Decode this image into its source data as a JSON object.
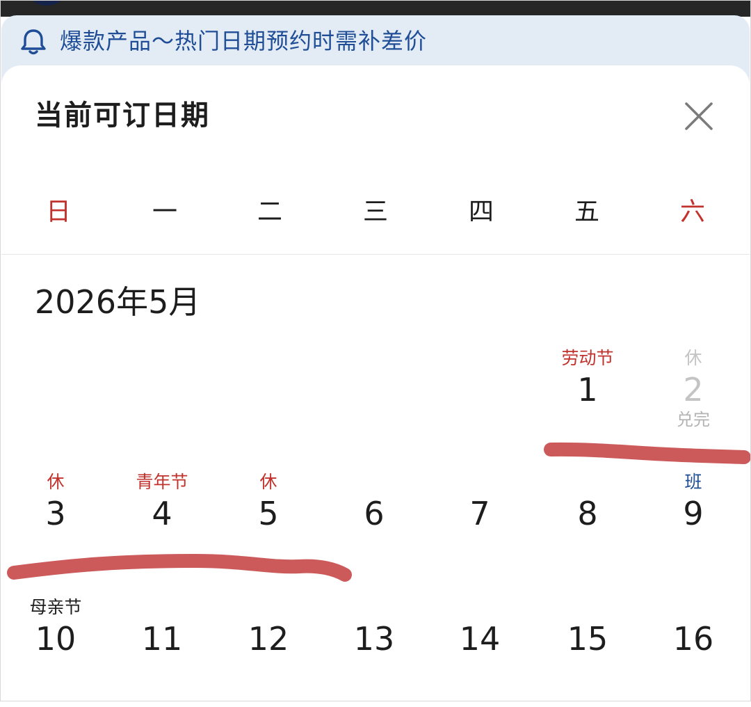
{
  "notice": {
    "icon": "bell-icon",
    "text": "爆款产品～热门日期预约时需补差价"
  },
  "sheet": {
    "title": "当前可订日期",
    "close_icon": "close-icon"
  },
  "weekdays": [
    "日",
    "一",
    "二",
    "三",
    "四",
    "五",
    "六"
  ],
  "month": "2026年5月",
  "days": [
    {
      "day": "1",
      "top": "劳动节",
      "top_style": "holiday"
    },
    {
      "day": "2",
      "top": "休",
      "bottom": "兑完",
      "disabled": true
    },
    {
      "day": "3",
      "top": "休",
      "top_style": "holiday"
    },
    {
      "day": "4",
      "top": "青年节",
      "top_style": "holiday"
    },
    {
      "day": "5",
      "top": "休",
      "top_style": "holiday"
    },
    {
      "day": "6"
    },
    {
      "day": "7"
    },
    {
      "day": "8"
    },
    {
      "day": "9",
      "top": "班",
      "top_style": "work"
    },
    {
      "day": "10",
      "top": "母亲节",
      "top_style": "dark"
    },
    {
      "day": "11"
    },
    {
      "day": "12"
    },
    {
      "day": "13"
    },
    {
      "day": "14"
    },
    {
      "day": "15"
    },
    {
      "day": "16"
    }
  ],
  "colors": {
    "weekend": "#c2322c",
    "holiday": "#c2322c",
    "work": "#1f4e97",
    "notice_bg": "#e3ebf5",
    "notice_text": "#1f4e97",
    "annotation_stroke": "#cc5a5a"
  }
}
